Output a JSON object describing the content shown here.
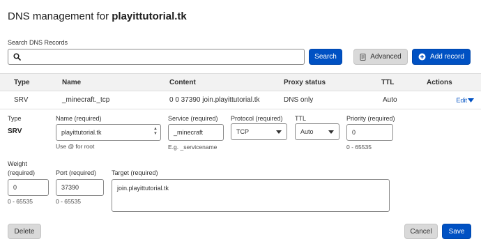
{
  "header": {
    "title_prefix": "DNS management for",
    "domain": "playittutorial.tk"
  },
  "search": {
    "label": "Search DNS Records",
    "value": "",
    "button_label": "Search",
    "icon": "search-icon"
  },
  "toolbar": {
    "advanced_label": "Advanced",
    "advanced_icon": "document-icon",
    "add_record_label": "Add record",
    "add_record_icon": "plus-circle-icon"
  },
  "table": {
    "columns": [
      "Type",
      "Name",
      "Content",
      "Proxy status",
      "TTL",
      "Actions"
    ],
    "row": {
      "type": "SRV",
      "name": "_minecraft._tcp",
      "content": "0 0 37390 join.playittutorial.tk",
      "proxy_status": "DNS only",
      "ttl": "Auto",
      "action": "Edit",
      "action_icon": "caret-down-icon"
    }
  },
  "edit_form": {
    "type_label": "Type",
    "type_value": "SRV",
    "name_label": "Name (required)",
    "name_value": "playittutorial.tk",
    "name_hint": "Use @ for root",
    "service_label": "Service (required)",
    "service_value": "_minecraft",
    "service_hint": "E.g. _servicename",
    "protocol_label": "Protocol (required)",
    "protocol_value": "TCP",
    "ttl_label": "TTL",
    "ttl_value": "Auto",
    "priority_label": "Priority (required)",
    "priority_value": "0",
    "priority_hint": "0 - 65535",
    "weight_label_1": "Weight",
    "weight_label_2": "(required)",
    "weight_value": "0",
    "weight_hint": "0 - 65535",
    "port_label": "Port (required)",
    "port_value": "37390",
    "port_hint": "0 - 65535",
    "target_label": "Target (required)",
    "target_value": "join.playittutorial.tk",
    "delete_label": "Delete",
    "cancel_label": "Cancel",
    "save_label": "Save"
  },
  "colors": {
    "primary": "#0051c3",
    "secondary_button": "#d9d9d9",
    "header_bg": "#f2f2f2",
    "border": "#8a8a8a"
  }
}
